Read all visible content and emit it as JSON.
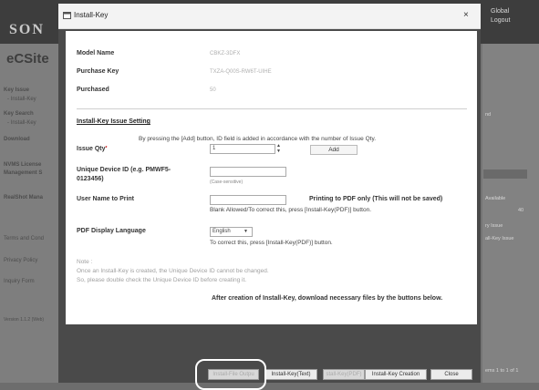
{
  "background": {
    "logo": "SON",
    "site_title": "eCSite",
    "header_right": [
      "Global",
      "Logout"
    ],
    "sidebar_items": [
      "Key Issue",
      "- Install-Key",
      "Key Search",
      "- Install-Key",
      "Download",
      "NVMS License",
      "Management S",
      "RealShot Mana",
      "Terms and Cond",
      "Privacy Policy",
      "Inquiry Form",
      "Version 1.1.2 (Web)"
    ],
    "right_texts": [
      "nd",
      "Available",
      "40",
      "ry Issue",
      "all-Key Issue",
      "ems 1 to 1 of 1"
    ]
  },
  "dialog": {
    "title": "Install-Key",
    "close": "×",
    "model_name_label": "Model Name",
    "model_name_value": "CBKZ-3DFX",
    "purchase_key_label": "Purchase Key",
    "purchase_key_value": "TXZA-Q00S-RW6T-UIHE",
    "purchased_label": "Purchased",
    "purchased_value": "50",
    "section_title": "Install-Key Issue Setting",
    "add_instruction": "By pressing the [Add] button, ID field is added in accordance with the number of Issue Qty.",
    "issue_qty_label": "Issue Qty",
    "issue_qty_required": "*",
    "issue_qty_value": "1",
    "add_button": "Add",
    "device_id_label": "Unique Device ID (e.g. PMWF5-0123456)",
    "device_id_hint": "(Case-sensitive)",
    "user_name_label": "User Name to Print",
    "print_pdf_note": "Printing to PDF only (This will not be saved)",
    "blank_note": "Blank Allowed/To correct this, press [Install-Key(PDF)] button.",
    "pdf_lang_label": "PDF Display Language",
    "pdf_lang_value": "English",
    "pdf_lang_note": "To correct this, press [Install-Key(PDF)] button.",
    "note_title": "Note :",
    "note_line1": "Once an Install-Key is created, the Unique Device ID cannot be changed.",
    "note_line2": "So, please double check the Unique Device ID before creating it.",
    "after_creation": "After creation of Install-Key, download necessary files by the buttons below."
  },
  "footer_buttons": [
    "Install-File Outpu",
    "Install-Key(Text)",
    "stall-Key(PDF)",
    "Install-Key Creation",
    "Close"
  ]
}
